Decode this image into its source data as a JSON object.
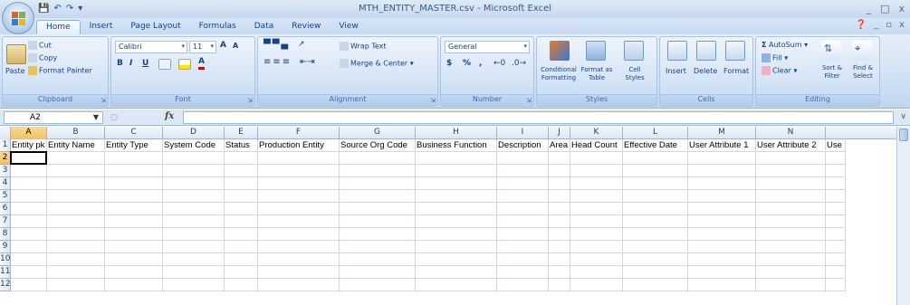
{
  "window": {
    "title": "MTH_ENTITY_MASTER.csv - Microsoft Excel",
    "controls": [
      "_",
      "□",
      "x"
    ]
  },
  "qat": {
    "save_icon": "save-icon",
    "undo_icon": "undo-icon",
    "redo_icon": "redo-icon"
  },
  "tabs": [
    "Home",
    "Insert",
    "Page Layout",
    "Formulas",
    "Data",
    "Review",
    "View"
  ],
  "active_tab": "Home",
  "ribbon": {
    "clipboard": {
      "label": "Clipboard",
      "paste": "Paste",
      "cut": "Cut",
      "copy": "Copy",
      "format_painter": "Format Painter"
    },
    "font": {
      "label": "Font",
      "name": "Calibri",
      "size": "11",
      "bold": "B",
      "italic": "I",
      "underline": "U",
      "grow": "A",
      "shrink": "A"
    },
    "alignment": {
      "label": "Alignment",
      "wrap_text": "Wrap Text",
      "merge_center": "Merge & Center"
    },
    "number": {
      "label": "Number",
      "format": "General",
      "currency": "$",
      "percent": "%",
      "comma": ","
    },
    "styles": {
      "label": "Styles",
      "conditional": "Conditional Formatting",
      "format_table": "Format as Table",
      "cell_styles": "Cell Styles"
    },
    "cells": {
      "label": "Cells",
      "insert": "Insert",
      "delete": "Delete",
      "format": "Format"
    },
    "editing": {
      "label": "Editing",
      "autosum": "AutoSum",
      "fill": "Fill",
      "clear": "Clear",
      "sort_filter": "Sort & Filter",
      "find_select": "Find & Select"
    }
  },
  "formula_bar": {
    "name_box": "A2",
    "fx": "fx",
    "value": ""
  },
  "grid": {
    "columns": [
      "A",
      "B",
      "C",
      "D",
      "E",
      "F",
      "G",
      "H",
      "I",
      "J",
      "K",
      "L",
      "M",
      "N"
    ],
    "selected_column": "A",
    "rows": [
      "1",
      "2",
      "3",
      "4",
      "5",
      "6",
      "7",
      "8",
      "9",
      "10",
      "11",
      "12"
    ],
    "selected_row": "2",
    "header_row": [
      "Entity pk",
      "Entity Name",
      "Entity Type",
      "System Code",
      "Status",
      "Production Entity",
      "Source Org Code",
      "Business Function",
      "Description",
      "Area",
      "Head Count",
      "Effective Date",
      "User Attribute 1",
      "User Attribute 2",
      "Use"
    ]
  },
  "colors": {
    "accent": "#15428b",
    "ribbon": "#cddff4",
    "selected_header": "#f1c15f",
    "gridline": "#d0d7e5"
  }
}
